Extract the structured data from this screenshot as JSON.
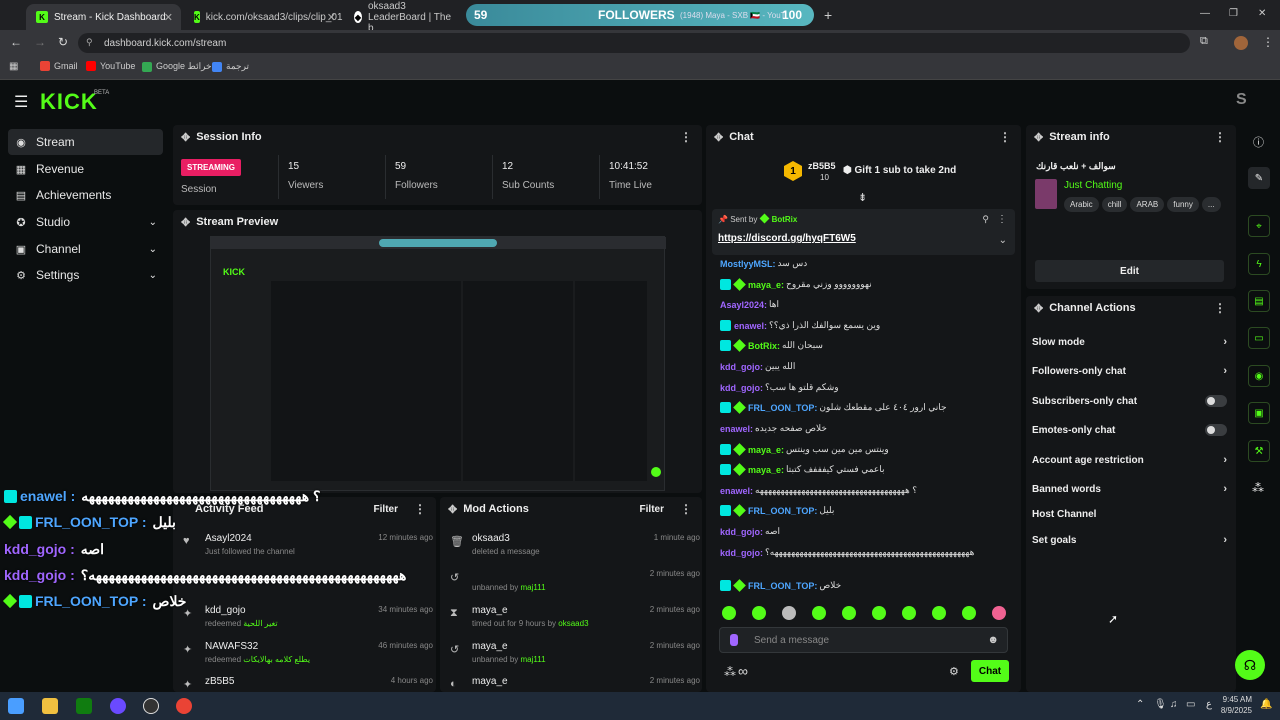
{
  "browser": {
    "tabs": [
      {
        "title": "Stream - Kick Dashboard",
        "active": true
      },
      {
        "title": "kick.com/oksaad3/clips/clip_01",
        "active": false
      },
      {
        "title": "oksaad3 LeaderBoard | The b",
        "active": false
      }
    ],
    "new_tab": "+",
    "url": "dashboard.kick.com/stream",
    "bookmarks": [
      "Gmail",
      "YouTube",
      "Google خرائط",
      "ترجمة"
    ],
    "window_controls": [
      "—",
      "❐",
      "✕"
    ]
  },
  "followers_overlay": {
    "left_value": "59",
    "label": "FOLLOWERS",
    "extra": "(1948) Maya - SXB 🇰🇼 - YouT",
    "right_value": "100"
  },
  "kick": {
    "logo": "KICK",
    "beta": "BETA",
    "avatar_letter": "S"
  },
  "sidebar": {
    "items": [
      {
        "label": "Stream",
        "icon": "◉"
      },
      {
        "label": "Revenue",
        "icon": "▦"
      },
      {
        "label": "Achievements",
        "icon": "▤"
      },
      {
        "label": "Studio",
        "icon": "✪",
        "chevron": "⌄"
      },
      {
        "label": "Channel",
        "icon": "▣",
        "chevron": "⌄"
      },
      {
        "label": "Settings",
        "icon": "⚙",
        "chevron": "⌄"
      }
    ]
  },
  "session": {
    "title": "Session Info",
    "status": "STREAMING",
    "status_label": "Session",
    "stats": [
      {
        "value": "15",
        "label": "Viewers"
      },
      {
        "value": "59",
        "label": "Followers"
      },
      {
        "value": "12",
        "label": "Sub Counts"
      },
      {
        "value": "10:41:52",
        "label": "Time Live"
      }
    ]
  },
  "preview": {
    "title": "Stream Preview"
  },
  "activity": {
    "title": "Activity Feed",
    "filter": "Filter",
    "rows": [
      {
        "name": "Asayl2024",
        "sub": "Just followed the channel",
        "time": "12 minutes ago",
        "icon": "♥"
      },
      {
        "name": "kdd_gojo",
        "sub": "redeemed",
        "reward": "تغير اللحية",
        "time": "34 minutes ago",
        "icon": "✦"
      },
      {
        "name": "NAWAFS32",
        "sub": "redeemed",
        "reward": "يطلع كلامه بهالايكات",
        "time": "46 minutes ago",
        "icon": "✦"
      },
      {
        "name": "zB5B5",
        "sub": "",
        "time": "4 hours ago",
        "icon": "✦"
      }
    ]
  },
  "mod": {
    "title": "Mod Actions",
    "filter": "Filter",
    "rows": [
      {
        "name": "oksaad3",
        "sub": "deleted a message",
        "time": "1 minute ago",
        "icon": "🗑"
      },
      {
        "name": "",
        "sub": "unbanned by",
        "by": "maj111",
        "time": "2 minutes ago",
        "icon": "↺"
      },
      {
        "name": "maya_e",
        "sub": "timed out for 9 hours by",
        "by": "oksaad3",
        "time": "2 minutes ago",
        "icon": "⧗"
      },
      {
        "name": "maya_e",
        "sub": "unbanned by",
        "by": "maj111",
        "time": "2 minutes ago",
        "icon": "↺"
      },
      {
        "name": "maya_e",
        "sub": "",
        "time": "2 minutes ago",
        "icon": "◐"
      }
    ]
  },
  "chat": {
    "title": "Chat",
    "leader": {
      "rank": "1",
      "name": "zB5B5",
      "count": "10"
    },
    "gift_text": "Gift 1 sub to take 2nd",
    "pinned": {
      "sent_by": "Sent by",
      "bot": "BotRix",
      "link": "https://discord.gg/hyqFT6W5"
    },
    "messages": [
      {
        "user": "MostlyyMSL:",
        "text": "دس سد",
        "color": "blue",
        "badges": ""
      },
      {
        "user": "maya_e:",
        "text": "نهووووووو وزني مقروح",
        "color": "green",
        "badges": "sd"
      },
      {
        "user": "Asayl2024:",
        "text": "اها",
        "color": "purple",
        "badges": ""
      },
      {
        "user": "enawel:",
        "text": "وين يسمع سوالفك الذرا ذي؟؟",
        "color": "purple",
        "badges": "s"
      },
      {
        "user": "BotRix:",
        "text": "سبحان الله",
        "color": "green",
        "badges": "sd"
      },
      {
        "user": "kdd_gojo:",
        "text": "الله يبين",
        "color": "purple",
        "badges": ""
      },
      {
        "user": "kdd_gojo:",
        "text": "وشكم قلتو ها سب؟",
        "color": "purple",
        "badges": ""
      },
      {
        "user": "FRL_OON_TOP:",
        "text": "جاني ارور ٤٠٤ على مقطعك شلون",
        "color": "blue",
        "badges": "sd"
      },
      {
        "user": "enawel:",
        "text": "خلاص صفحه جديده",
        "color": "purple",
        "badges": ""
      },
      {
        "user": "maya_e:",
        "text": "وينتس مين مين سب وينتس",
        "color": "green",
        "badges": "sd"
      },
      {
        "user": "maya_e:",
        "text": "باعمي فستي كيفففف كتبتا",
        "color": "green",
        "badges": "sd"
      },
      {
        "user": "enawel:",
        "text": "؟ ههههههههههههههههههههههههههههههههههههه",
        "color": "purple",
        "badges": ""
      },
      {
        "user": "FRL_OON_TOP:",
        "text": "بليل",
        "color": "blue",
        "badges": "sd"
      },
      {
        "user": "kdd_gojo:",
        "text": "اصه",
        "color": "purple",
        "badges": ""
      },
      {
        "user": "kdd_gojo:",
        "text": "ههههههههههههههههههههههههههههههههههههههههههههههههه؟",
        "color": "purple",
        "badges": ""
      },
      {
        "user": "FRL_OON_TOP:",
        "text": "خلاص",
        "color": "blue",
        "badges": "sd"
      }
    ],
    "input_placeholder": "Send a message",
    "send": "Chat",
    "infinity": "∞"
  },
  "stream_info": {
    "title": "Stream info",
    "stream_title": "سوالف + نلعب قارنك",
    "category": "Just Chatting",
    "tags": [
      "Arabic",
      "chill",
      "ARAB",
      "funny",
      "..."
    ],
    "edit": "Edit"
  },
  "channel_actions": {
    "title": "Channel Actions",
    "items": [
      {
        "label": "Slow mode",
        "type": "chevron"
      },
      {
        "label": "Followers-only chat",
        "type": "chevron"
      },
      {
        "label": "Subscribers-only chat",
        "type": "toggle"
      },
      {
        "label": "Emotes-only chat",
        "type": "toggle"
      },
      {
        "label": "Account age restriction",
        "type": "chevron"
      },
      {
        "label": "Banned words",
        "type": "chevron"
      },
      {
        "label": "Host Channel",
        "type": "none"
      },
      {
        "label": "Set goals",
        "type": "chevron"
      }
    ]
  },
  "overlay_chat": [
    {
      "user": "enawel :",
      "text": "؟ ههههههههههههههههههههههههههههههههههه",
      "color": "blue",
      "badges": "s"
    },
    {
      "user": "FRL_OON_TOP :",
      "text": "بليل",
      "color": "blue",
      "badges": "sd"
    },
    {
      "user": "kdd_gojo :",
      "text": "اصه",
      "color": "purple",
      "badges": ""
    },
    {
      "user": "kdd_gojo :",
      "text": "ههههههههههههههههههههههههههههههههههههههههههههههههه؟",
      "color": "purple",
      "badges": ""
    },
    {
      "user": "FRL_OON_TOP :",
      "text": "خلاص",
      "color": "blue",
      "badges": "sd"
    }
  ],
  "taskbar": {
    "time": "9:45 AM",
    "date": "8/9/2025",
    "lang": "ع"
  },
  "colors": {
    "accent": "#53fc18",
    "live": "#e91e63",
    "bg": "#0b0e0f",
    "panel": "#141618"
  }
}
